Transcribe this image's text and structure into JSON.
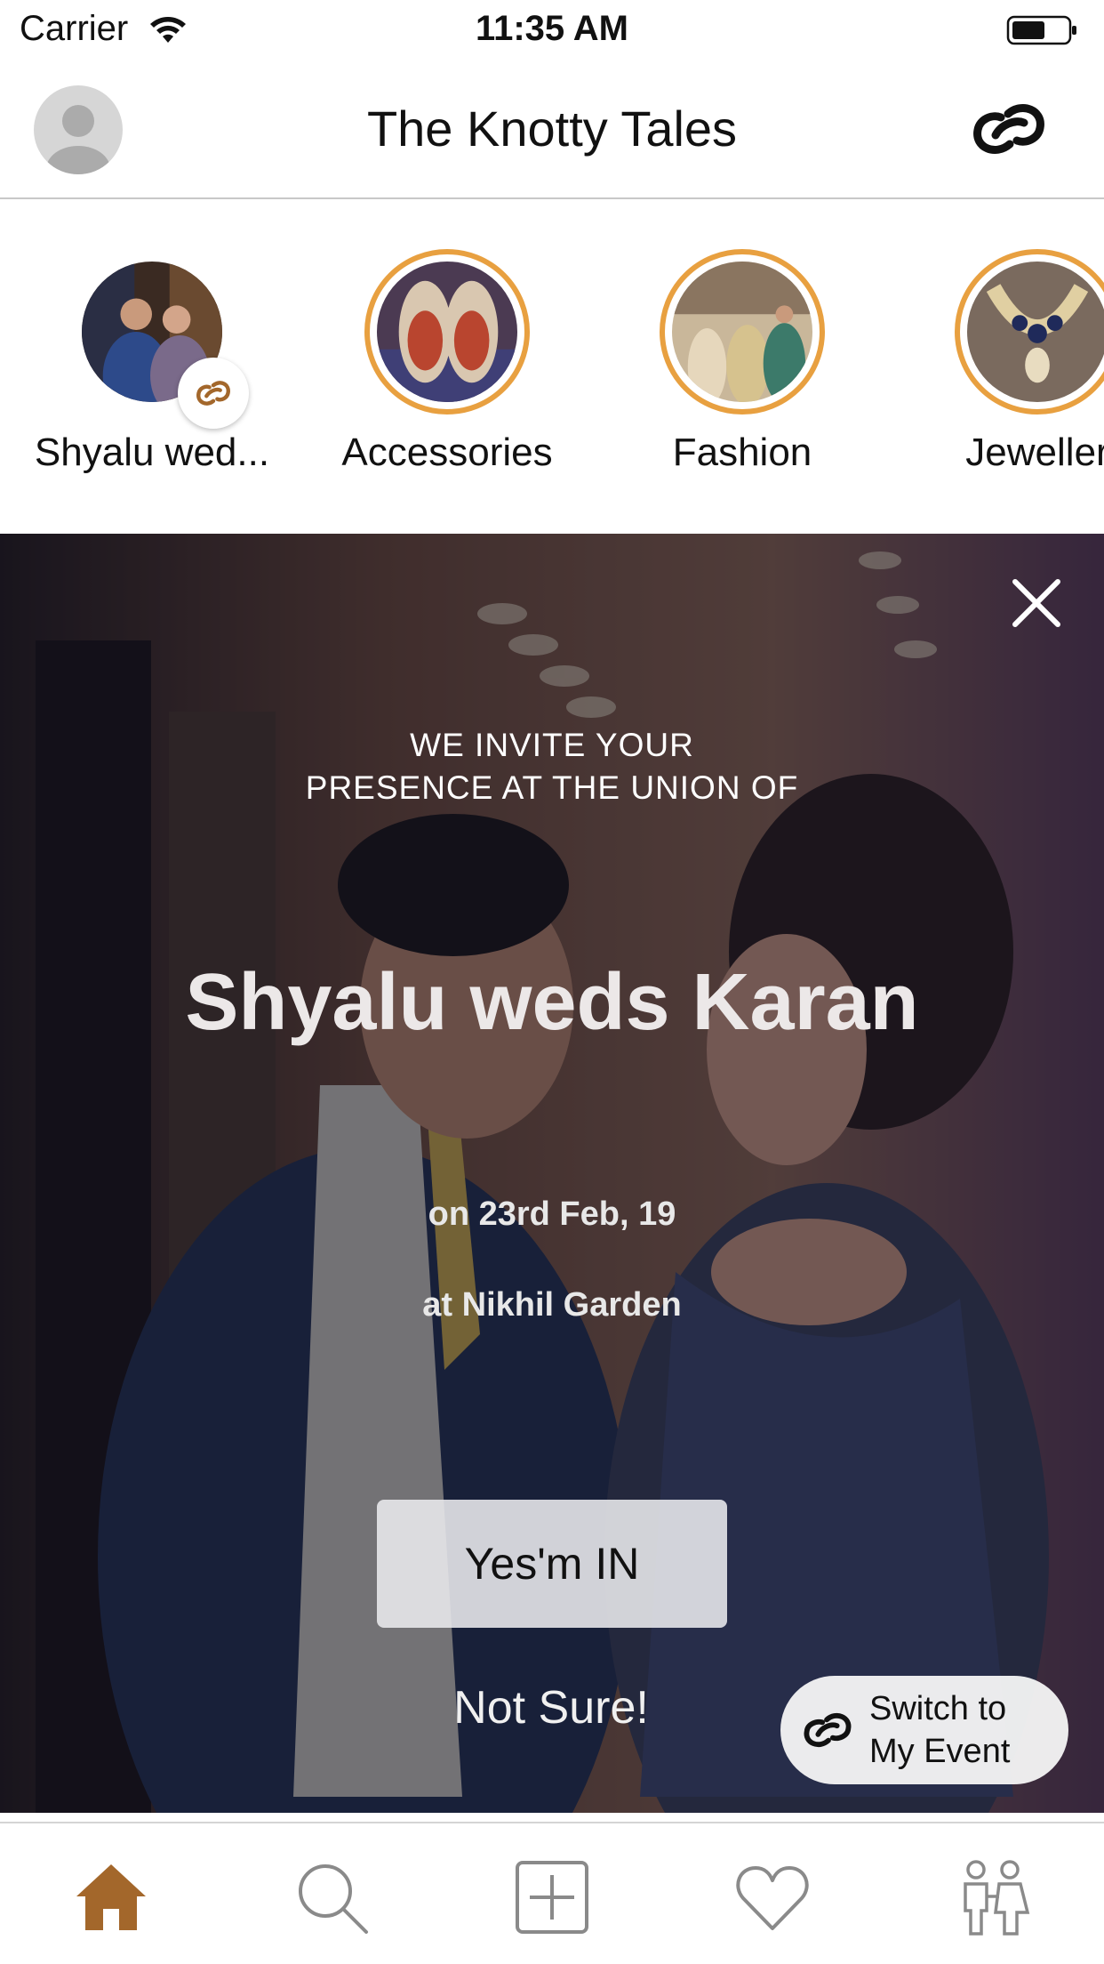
{
  "status_bar": {
    "carrier": "Carrier",
    "time": "11:35 AM",
    "wifi_icon": "wifi-icon",
    "battery_icon": "battery-icon"
  },
  "nav": {
    "title": "The Knotty Tales",
    "avatar_icon": "user-avatar-icon",
    "right_icon": "link-rings-icon"
  },
  "stories": [
    {
      "label": "Shyalu wed...",
      "has_badge": true,
      "badge_icon": "link-rings-icon"
    },
    {
      "label": "Accessories"
    },
    {
      "label": "Fashion"
    },
    {
      "label": "Jeweller"
    }
  ],
  "invite": {
    "pre_line1": "WE INVITE YOUR",
    "pre_line2": "PRESENCE AT THE UNION OF",
    "names": "Shyalu weds Karan",
    "date": "on 23rd Feb, 19",
    "venue": "at Nikhil Garden",
    "yes_label": "Yes'm IN",
    "not_sure_label": "Not Sure!",
    "switch_line1": "Switch to",
    "switch_line2": "My Event"
  },
  "tab_bar": {
    "items": [
      "home-icon",
      "search-icon",
      "add-post-icon",
      "heart-icon",
      "couple-icon"
    ],
    "active": "home-icon"
  },
  "colors": {
    "accent": "#E8A040",
    "tab_active": "#A3672B",
    "tab_inactive": "#8A8A8A"
  }
}
